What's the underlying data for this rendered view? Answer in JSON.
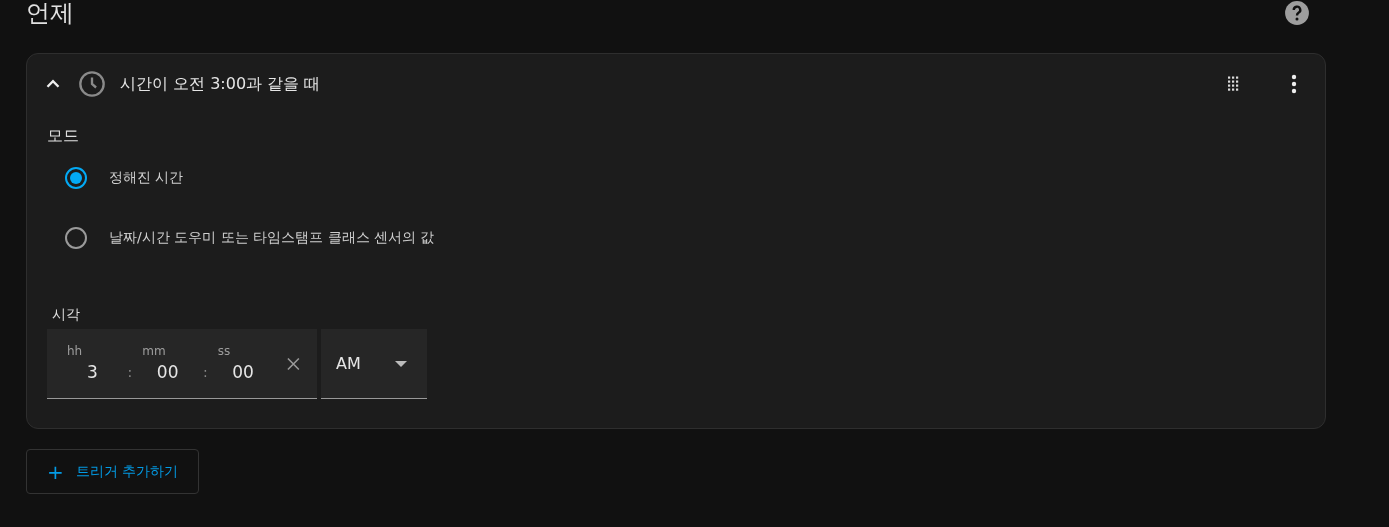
{
  "section": {
    "title": "언제"
  },
  "trigger": {
    "expanded": true,
    "title": "시간이 오전 3:00과 같을 때",
    "mode": {
      "label": "모드",
      "options": [
        {
          "label": "정해진 시간",
          "selected": true
        },
        {
          "label": "날짜/시간 도우미 또는 타임스탬프 클래스 센서의 값",
          "selected": false
        }
      ]
    },
    "time": {
      "label": "시각",
      "parts": [
        {
          "label": "hh",
          "value": "3"
        },
        {
          "label": "mm",
          "value": "00"
        },
        {
          "label": "ss",
          "value": "00"
        }
      ],
      "separator": ":",
      "period": "AM"
    }
  },
  "add_button": {
    "label": "트리거 추가하기",
    "icon": "+"
  }
}
